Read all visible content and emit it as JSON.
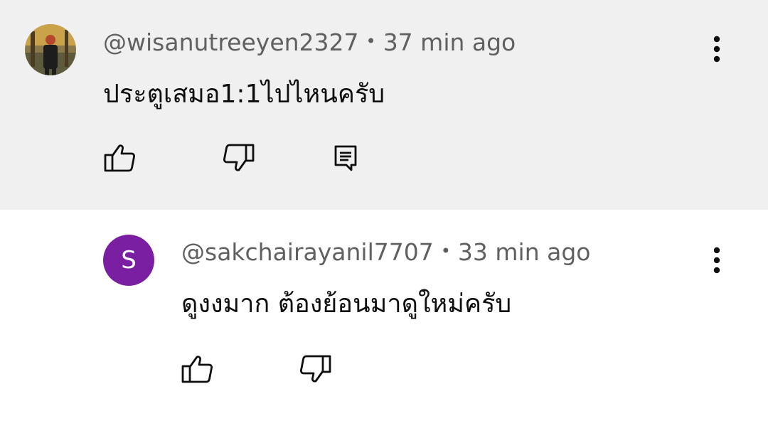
{
  "comments": [
    {
      "handle": "@wisanutreeyen2327",
      "separator": "•",
      "time": "37 min ago",
      "text": "ประตูเสมอ1:1ไปไหนครับ",
      "avatar": "photo-avatar",
      "highlighted_bg": "#f0f0f0"
    },
    {
      "handle": "@sakchairayanil7707",
      "separator": "•",
      "time": "33 min ago",
      "text": "ดูงงมาก ต้องย้อนมาดูใหม่ครับ",
      "avatar_letter": "S",
      "avatar_color": "#7b1fa2"
    }
  ],
  "icons": [
    "like-icon",
    "dislike-icon",
    "reply-icon",
    "more-vert-icon"
  ]
}
